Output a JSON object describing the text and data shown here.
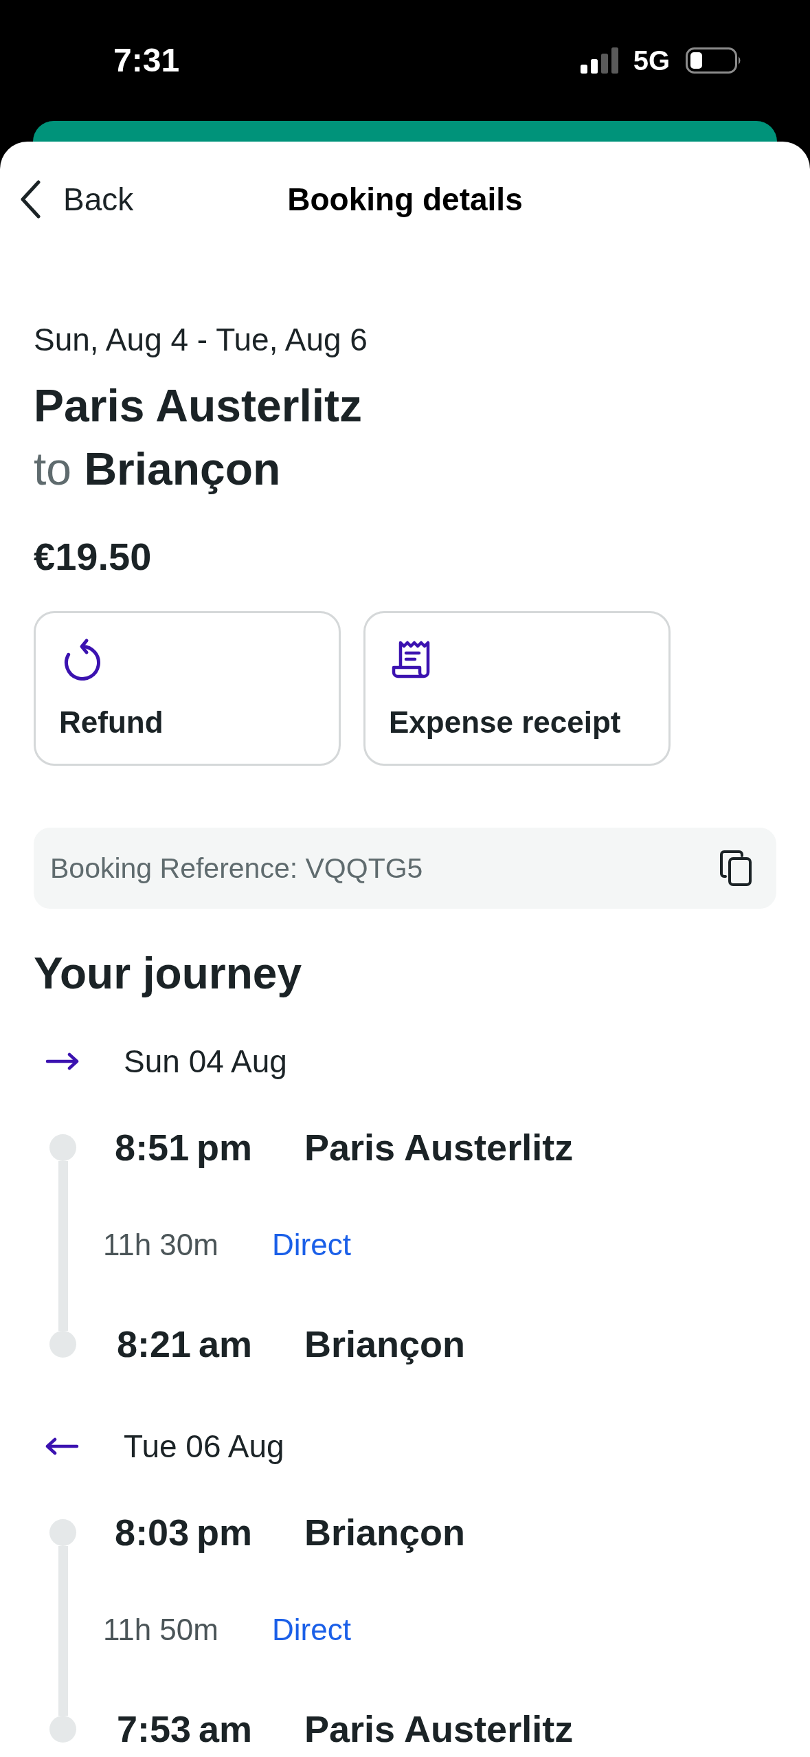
{
  "status_bar": {
    "time": "7:31",
    "network": "5G"
  },
  "header": {
    "back_label": "Back",
    "title": "Booking details"
  },
  "trip": {
    "dates": "Sun, Aug 4 - Tue, Aug 6",
    "origin": "Paris Austerlitz",
    "connector": "to",
    "destination": "Briançon",
    "price": "€19.50"
  },
  "actions": [
    {
      "kind": "refund",
      "label": "Refund"
    },
    {
      "kind": "receipt",
      "label": "Expense receipt"
    }
  ],
  "booking_reference": "Booking Reference: VQQTG5",
  "journey": {
    "title": "Your journey",
    "legs": [
      {
        "kind": "outbound",
        "date": "Sun 04 Aug",
        "departure": {
          "time": "8:51 pm",
          "station": "Paris Austerlitz"
        },
        "duration": "11h 30m",
        "service": "Direct",
        "arrival": {
          "time": "8:21 am",
          "station": "Briançon"
        }
      },
      {
        "kind": "return",
        "date": "Tue 06 Aug",
        "departure": {
          "time": "8:03 pm",
          "station": "Briançon"
        },
        "duration": "11h 50m",
        "service": "Direct",
        "arrival": {
          "time": "7:53 am",
          "station": "Paris Austerlitz"
        }
      }
    ]
  }
}
